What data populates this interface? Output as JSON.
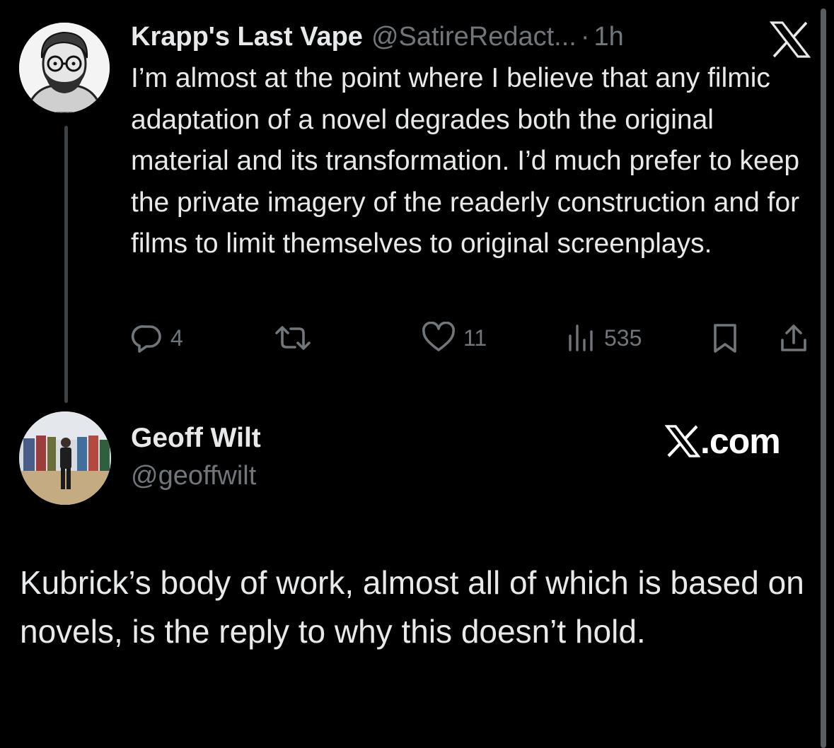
{
  "tweet": {
    "author_name": "Krapp's Last Vape",
    "author_handle": "@SatireRedact...",
    "separator": "·",
    "time": "1h",
    "text": "I’m almost at the point where I believe that any filmic adaptation of a novel degrades both the original material and its transformation. I’d much prefer to keep the private imagery of the readerly construction and for films to limit themselves to original screenplays.",
    "actions": {
      "reply_count": "4",
      "retweet_count": "",
      "like_count": "11",
      "views_count": "535"
    }
  },
  "reply": {
    "author_name": "Geoff Wilt",
    "author_handle": "@geoffwilt",
    "source_label": ".com",
    "text": "Kubrick’s body of work, almost all of which is based on novels, is the reply to why this doesn’t hold."
  },
  "icons": {
    "top_logo": "x-logo-icon",
    "reply": "reply-icon",
    "retweet": "retweet-icon",
    "like": "heart-icon",
    "views": "views-icon",
    "bookmark": "bookmark-icon",
    "share": "share-icon",
    "source_logo": "x-logo-icon"
  },
  "colors": {
    "background": "#000000",
    "text": "#e7e9ea",
    "muted": "#71767b",
    "thread_line": "#3e4144"
  }
}
